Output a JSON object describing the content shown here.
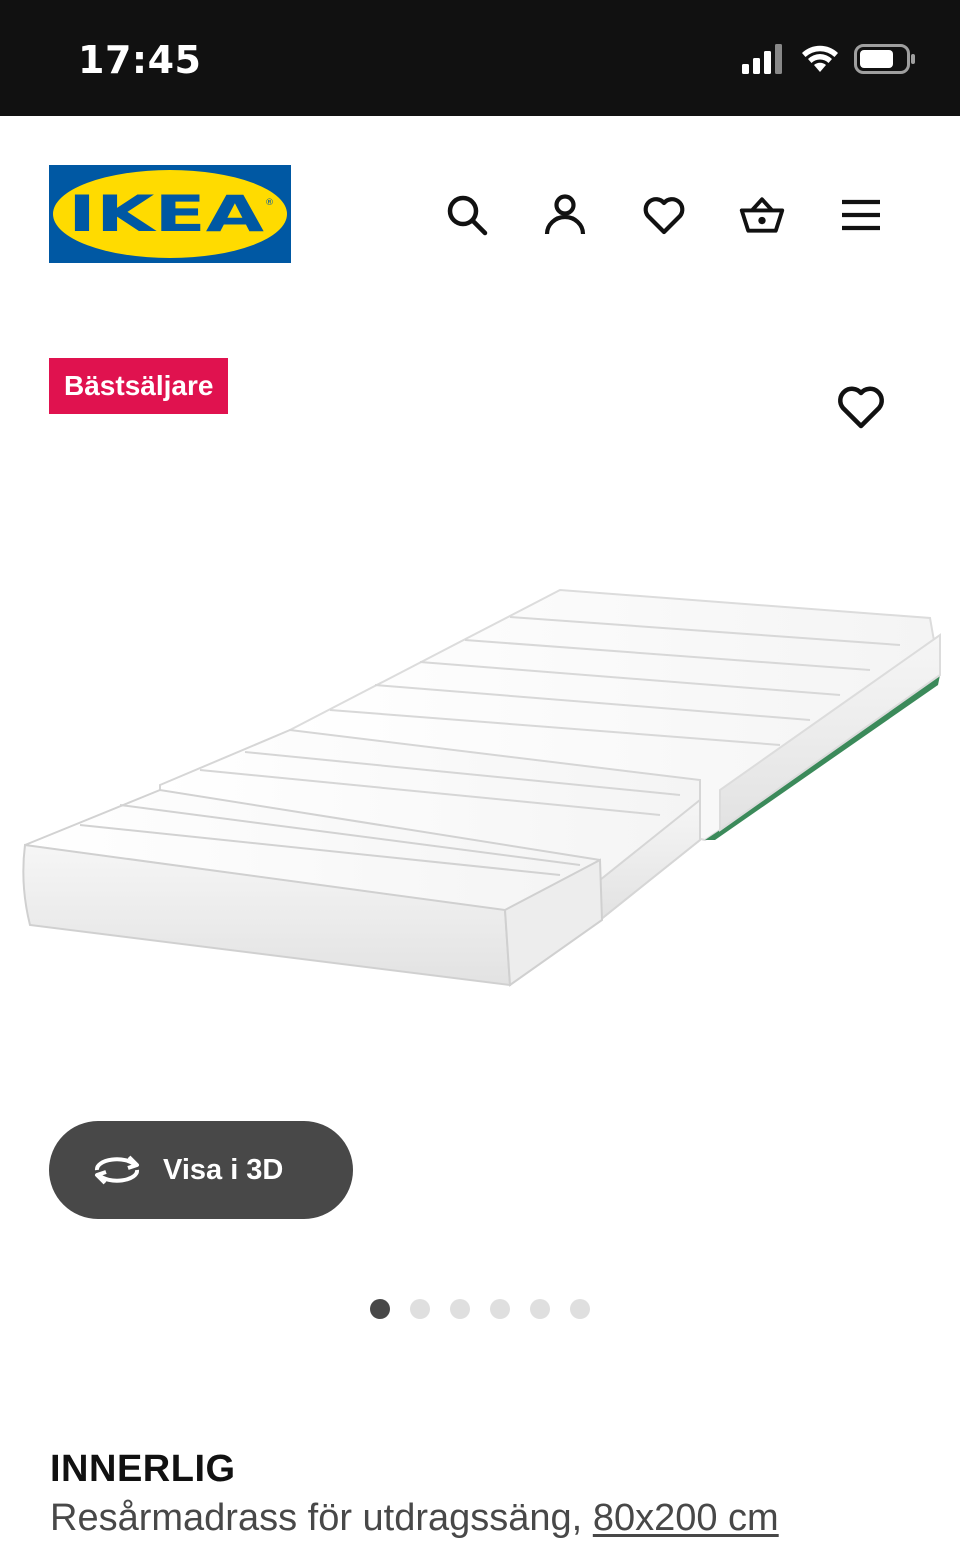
{
  "status_bar": {
    "time": "17:45"
  },
  "header": {
    "logo_text": "IKEA",
    "icons": [
      "search-icon",
      "account-icon",
      "heart-icon",
      "basket-icon",
      "menu-icon"
    ],
    "brand_blue": "#0058a3",
    "brand_yellow": "#ffdb00"
  },
  "badge": {
    "label": "Bästsäljare",
    "color": "#e0124f"
  },
  "gallery": {
    "view_3d_label": "Visa i 3D",
    "total_images": 6,
    "active_index": 1
  },
  "product": {
    "name": "INNERLIG",
    "description": "Resårmadrass för utdragssäng,",
    "size_link": "80x200 cm"
  }
}
